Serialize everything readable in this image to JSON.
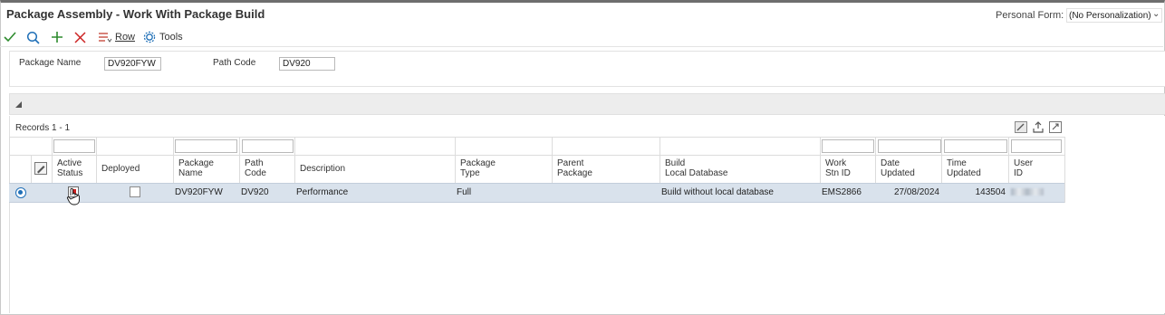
{
  "window": {
    "title": "Package Assembly - Work With Package Build",
    "personal_form_label": "Personal Form:",
    "personal_form_value": "(No Personalization)"
  },
  "toolbar": {
    "row_label": "Row",
    "tools_label": "Tools"
  },
  "criteria": {
    "package_name_label": "Package Name",
    "package_name_value": "DV920FYW",
    "path_code_label": "Path Code",
    "path_code_value": "DV920"
  },
  "grid": {
    "records_label": "Records 1 - 1",
    "columns": {
      "active_status": [
        "Active",
        "Status"
      ],
      "deployed": [
        "Deployed"
      ],
      "package_name": [
        "Package",
        "Name"
      ],
      "path_code": [
        "Path",
        "Code"
      ],
      "description": [
        "Description"
      ],
      "package_type": [
        "Package",
        "Type"
      ],
      "parent_package": [
        "Parent",
        "Package"
      ],
      "build_local_db": [
        "Build",
        "Local Database"
      ],
      "work_stn_id": [
        "Work",
        "Stn ID"
      ],
      "date_updated": [
        "Date",
        "Updated"
      ],
      "time_updated": [
        "Time",
        "Updated"
      ],
      "user_id": [
        "User",
        "ID"
      ]
    },
    "rows": [
      {
        "package_name": "DV920FYW",
        "path_code": "DV920",
        "description": "Performance",
        "package_type": "Full",
        "parent_package": "",
        "build_local_db": "Build without local database",
        "work_stn_id": "EMS2866",
        "date_updated": "27/08/2024",
        "time_updated": "143504",
        "active_status_checked": true,
        "deployed_checked": false
      }
    ]
  },
  "colors": {
    "accent_blue": "#1f6fb7",
    "selected_row": "#d9e2ec",
    "ok_green": "#2e8b2e",
    "cancel_red": "#cc2222"
  }
}
